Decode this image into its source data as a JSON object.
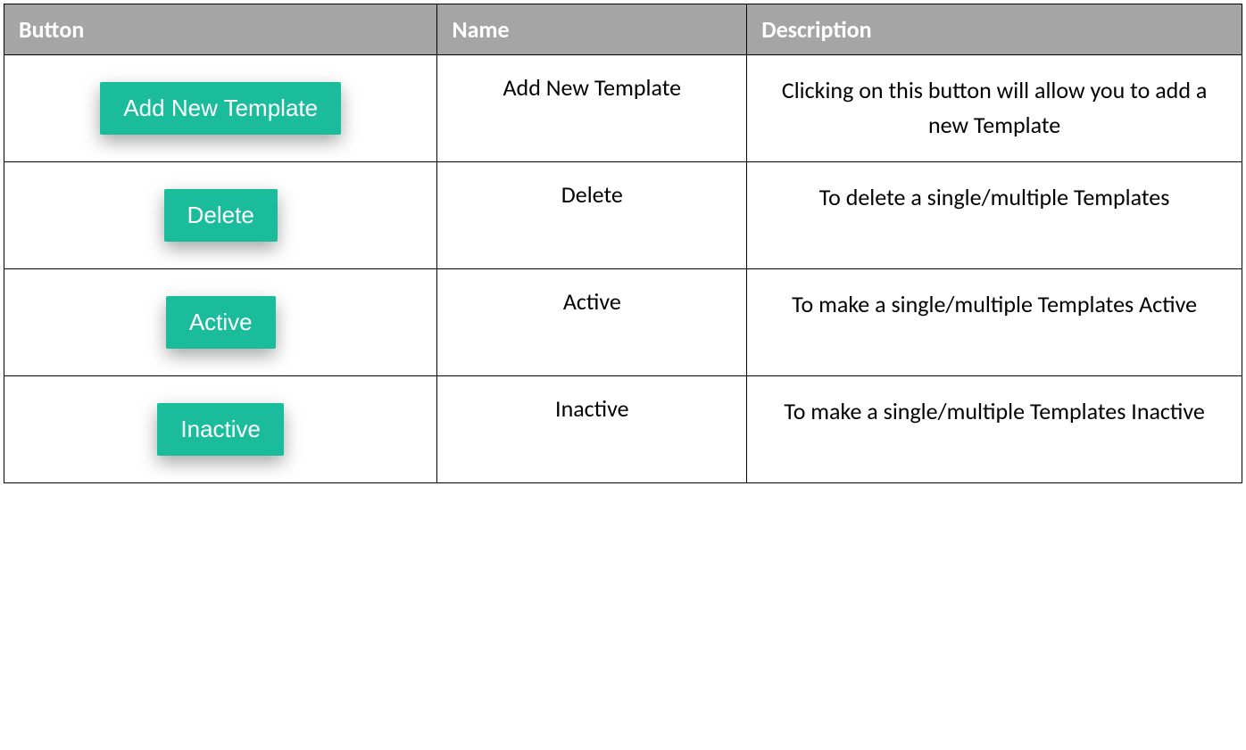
{
  "table": {
    "headers": {
      "button": "Button",
      "name": "Name",
      "description": "Description"
    },
    "rows": [
      {
        "button_label": "Add New Template",
        "name": "Add New Template",
        "description": "Clicking on this button will allow you to add a new Template"
      },
      {
        "button_label": "Delete",
        "name": "Delete",
        "description": "To delete a single/multiple Templates"
      },
      {
        "button_label": "Active",
        "name": "Active",
        "description": "To make a single/multiple Templates Active"
      },
      {
        "button_label": "Inactive",
        "name": "Inactive",
        "description": "To make a single/multiple Templates Inactive"
      }
    ]
  }
}
